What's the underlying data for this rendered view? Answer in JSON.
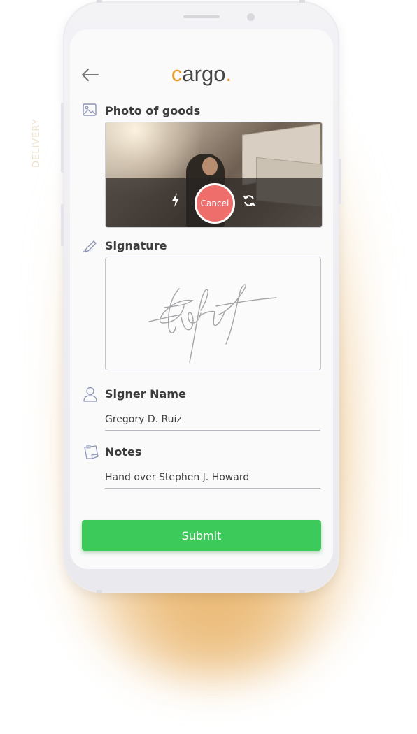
{
  "app": {
    "logo_c": "c",
    "logo_rest": "argo",
    "logo_dot": "."
  },
  "watermark": "DELIVERY",
  "photo_section": {
    "title": "Photo of goods",
    "cancel_label": "Cancel"
  },
  "signature_section": {
    "title": "Signature"
  },
  "signer_section": {
    "title": "Signer Name",
    "value": "Gregory D. Ruiz"
  },
  "notes_section": {
    "title": "Notes",
    "value": "Hand over Stephen J. Howard"
  },
  "submit_label": "Submit",
  "icons": {
    "back": "arrow-left-icon",
    "photo": "image-icon",
    "signature": "pen-icon",
    "signer": "user-icon",
    "notes": "note-icon",
    "flash": "flash-icon",
    "switch": "camera-switch-icon"
  },
  "colors": {
    "accent": "#e8992b",
    "submit": "#3ccb5b",
    "cancel": "#ee6e6c"
  }
}
